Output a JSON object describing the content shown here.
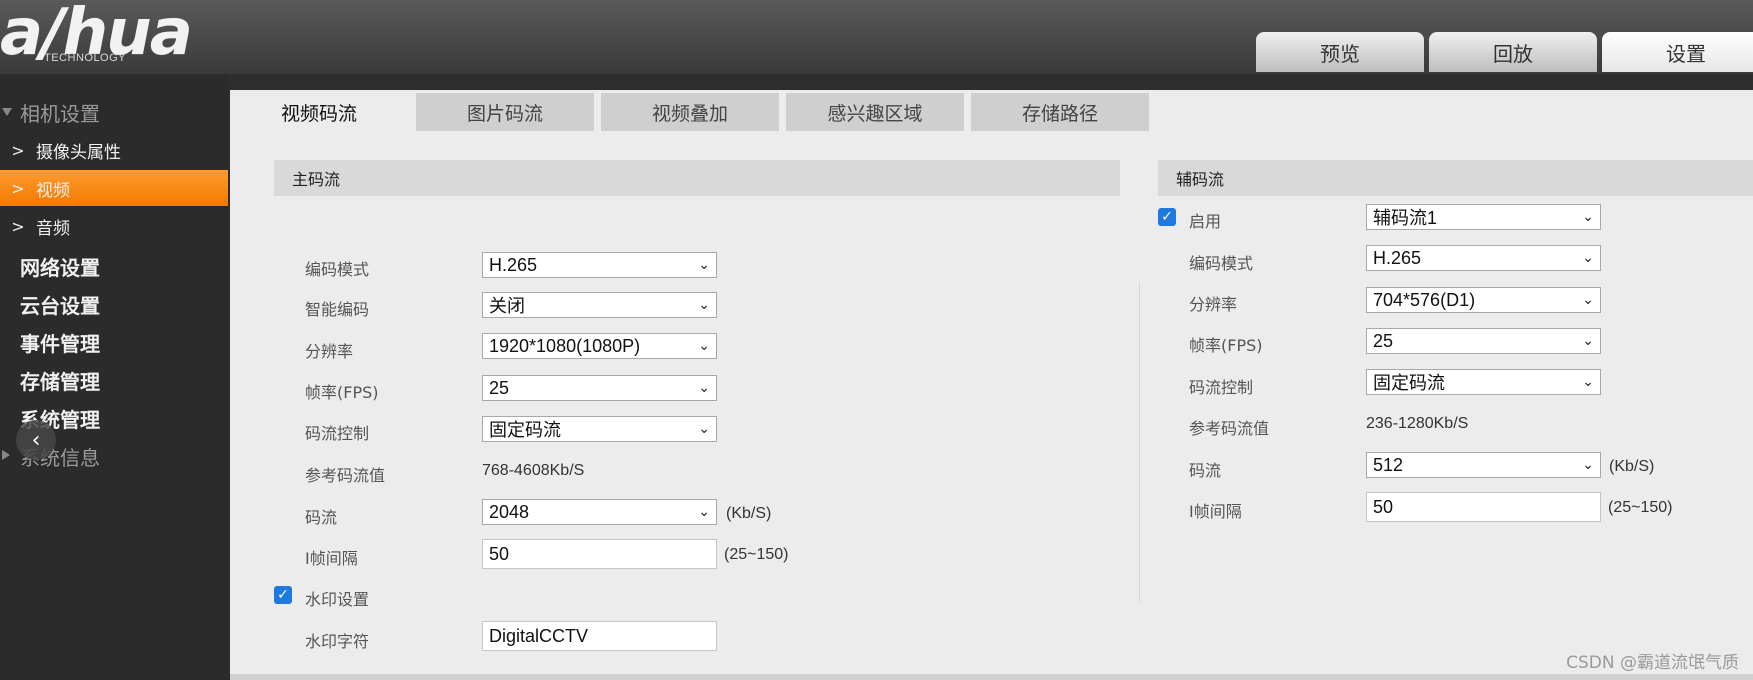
{
  "header": {
    "logo_main": "a/hua",
    "logo_sub": "TECHNOLOGY",
    "tabs": [
      {
        "label": "预览"
      },
      {
        "label": "回放"
      },
      {
        "label": "设置"
      }
    ]
  },
  "sidebar": {
    "groups": [
      {
        "label": "相机设置"
      },
      {
        "label": "网络设置"
      },
      {
        "label": "云台设置"
      },
      {
        "label": "事件管理"
      },
      {
        "label": "存储管理"
      },
      {
        "label": "系统管理"
      },
      {
        "label": "系统信息"
      }
    ],
    "items": [
      {
        "label": "摄像头属性"
      },
      {
        "label": "视频"
      },
      {
        "label": "音频"
      }
    ],
    "collapse_icon": "chevron-left-icon"
  },
  "tabs": [
    {
      "label": "视频码流"
    },
    {
      "label": "图片码流"
    },
    {
      "label": "视频叠加"
    },
    {
      "label": "感兴趣区域"
    },
    {
      "label": "存储路径"
    }
  ],
  "main_stream": {
    "title": "主码流",
    "encode_mode_label": "编码模式",
    "encode_mode": "H.265",
    "smart_codec_label": "智能编码",
    "smart_codec": "关闭",
    "resolution_label": "分辨率",
    "resolution": "1920*1080(1080P)",
    "fps_label": "帧率(FPS)",
    "fps": "25",
    "bitrate_ctrl_label": "码流控制",
    "bitrate_ctrl": "固定码流",
    "ref_bitrate_label": "参考码流值",
    "ref_bitrate": "768-4608Kb/S",
    "bitrate_label": "码流",
    "bitrate": "2048",
    "bitrate_unit": "(Kb/S)",
    "iframe_label": "I帧间隔",
    "iframe": "50",
    "iframe_range": "(25~150)",
    "watermark_enable_label": "水印设置",
    "watermark_enabled": true,
    "watermark_text_label": "水印字符",
    "watermark_text": "DigitalCCTV"
  },
  "sub_stream": {
    "title": "辅码流",
    "enable_label": "启用",
    "enabled": true,
    "stream": "辅码流1",
    "encode_mode_label": "编码模式",
    "encode_mode": "H.265",
    "resolution_label": "分辨率",
    "resolution": "704*576(D1)",
    "fps_label": "帧率(FPS)",
    "fps": "25",
    "bitrate_ctrl_label": "码流控制",
    "bitrate_ctrl": "固定码流",
    "ref_bitrate_label": "参考码流值",
    "ref_bitrate": "236-1280Kb/S",
    "bitrate_label": "码流",
    "bitrate": "512",
    "bitrate_unit": "(Kb/S)",
    "iframe_label": "I帧间隔",
    "iframe": "50",
    "iframe_range": "(25~150)"
  },
  "watermark_overlay": "CSDN @霸道流氓气质",
  "colors": {
    "accent": "#f58a1c",
    "checkbox": "#1f7ae0",
    "panel": "#ececec"
  }
}
